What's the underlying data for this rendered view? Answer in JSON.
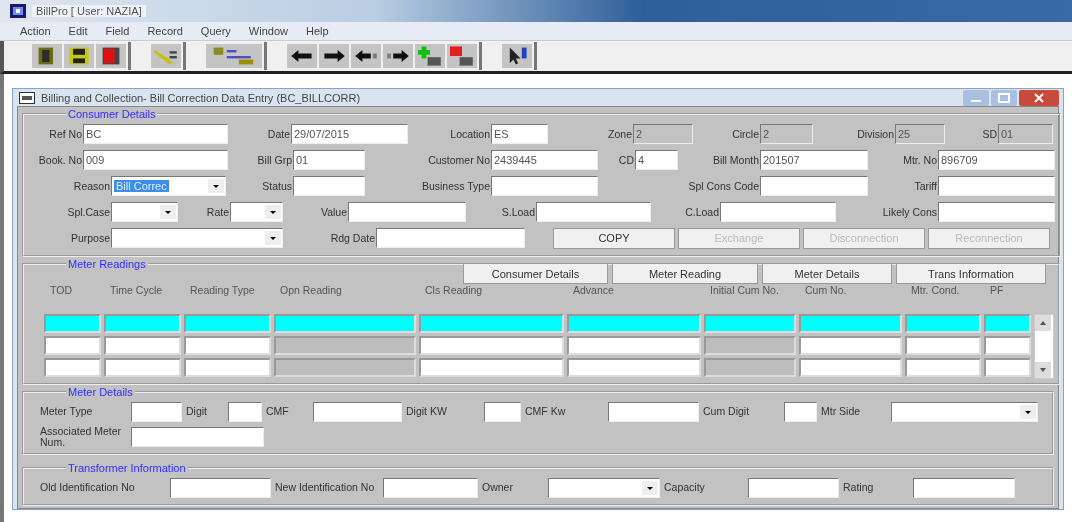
{
  "window": {
    "title": "BillPro [ User: NAZIA]"
  },
  "menu": [
    "Action",
    "Edit",
    "Field",
    "Record",
    "Query",
    "Window",
    "Help"
  ],
  "form": {
    "title": "Billing and Collection- Bill Correction Data Entry (BC_BILLCORR)"
  },
  "consumer": {
    "legend": "Consumer Details",
    "rows": [
      {
        "fields": [
          {
            "label": "Ref No",
            "value": "BC",
            "kind": "text"
          },
          {
            "label": "Date",
            "value": "29/07/2015",
            "kind": "text"
          },
          {
            "label": "Location",
            "value": "ES",
            "kind": "text"
          },
          {
            "label": "Zone",
            "value": "2",
            "kind": "readonly"
          },
          {
            "label": "Circle",
            "value": "2",
            "kind": "readonly"
          },
          {
            "label": "Division",
            "value": "25",
            "kind": "readonly"
          },
          {
            "label": "SD",
            "value": "01",
            "kind": "readonly"
          }
        ]
      },
      {
        "fields": [
          {
            "label": "Book. No",
            "value": "009",
            "kind": "text"
          },
          {
            "label": "Bill Grp",
            "value": "01",
            "kind": "text"
          },
          {
            "label": "Customer No",
            "value": "2439445",
            "kind": "text"
          },
          {
            "label": "CD",
            "value": "4",
            "kind": "text"
          },
          {
            "label": "Bill Month",
            "value": "201507",
            "kind": "text"
          },
          {
            "label": "Mtr. No",
            "value": "896709",
            "kind": "text"
          }
        ]
      },
      {
        "fields": [
          {
            "label": "Reason",
            "value": "Bill Correc",
            "kind": "select",
            "highlighted": true
          },
          {
            "label": "Status",
            "kind": "text"
          },
          {
            "label": "Business Type",
            "kind": "text"
          },
          {
            "label": "Spl Cons Code",
            "kind": "text"
          },
          {
            "label": "Tariff",
            "kind": "text"
          }
        ]
      },
      {
        "fields": [
          {
            "label": "Spl.Case",
            "kind": "select"
          },
          {
            "label": "Rate",
            "kind": "select"
          },
          {
            "label": "Value",
            "kind": "text"
          },
          {
            "label": "S.Load",
            "kind": "text"
          },
          {
            "label": "C.Load",
            "kind": "text"
          },
          {
            "label": "Likely Cons",
            "kind": "text"
          }
        ]
      },
      {
        "fields": [
          {
            "label": "Purpose",
            "kind": "select"
          },
          {
            "label": "Rdg Date",
            "kind": "text"
          }
        ]
      }
    ],
    "buttons": [
      {
        "label": "COPY",
        "disabled": false
      },
      {
        "label": "Exchange",
        "disabled": true
      },
      {
        "label": "Disconnection",
        "disabled": true
      },
      {
        "label": "Reconnection",
        "disabled": true
      }
    ]
  },
  "readings": {
    "legend": "Meter Readings",
    "buttons": [
      "Consumer Details",
      "Meter Reading",
      "Meter Details",
      "Trans Information"
    ],
    "columns": [
      {
        "label": "TOD",
        "readonly": false
      },
      {
        "label": "Time Cycle",
        "readonly": false
      },
      {
        "label": "Reading Type",
        "readonly": false
      },
      {
        "label": "Opn Reading",
        "readonly": true
      },
      {
        "label": "Cls Reading",
        "readonly": false
      },
      {
        "label": "Advance",
        "readonly": false
      },
      {
        "label": "Initial Cum No.",
        "readonly": true
      },
      {
        "label": "Cum No.",
        "readonly": false
      },
      {
        "label": "Mtr. Cond.",
        "readonly": false
      },
      {
        "label": "PF",
        "readonly": false
      }
    ],
    "rows": [
      {
        "selected": true
      },
      {
        "selected": false
      },
      {
        "selected": false
      }
    ]
  },
  "meter": {
    "legend": "Meter Details",
    "rows": [
      {
        "fields": [
          {
            "label": "Meter Type",
            "kind": "text"
          },
          {
            "label": "Digit",
            "kind": "text"
          },
          {
            "label": "CMF",
            "kind": "text"
          },
          {
            "label": "Digit KW",
            "kind": "text"
          },
          {
            "label": "CMF Kw",
            "kind": "text"
          },
          {
            "label": "Cum Digit",
            "kind": "text"
          },
          {
            "label": "Mtr Side",
            "kind": "select"
          }
        ]
      },
      {
        "fields": [
          {
            "label": "Associated Meter Num.",
            "kind": "text"
          }
        ]
      }
    ]
  },
  "transformer": {
    "legend": "Transformer Information",
    "rows": [
      {
        "fields": [
          {
            "label": "Old Identification No",
            "kind": "text"
          },
          {
            "label": "New Identification No",
            "kind": "text"
          },
          {
            "label": "Owner",
            "kind": "select"
          },
          {
            "label": "Capacity",
            "kind": "text"
          },
          {
            "label": "Rating",
            "kind": "text"
          }
        ]
      }
    ]
  }
}
